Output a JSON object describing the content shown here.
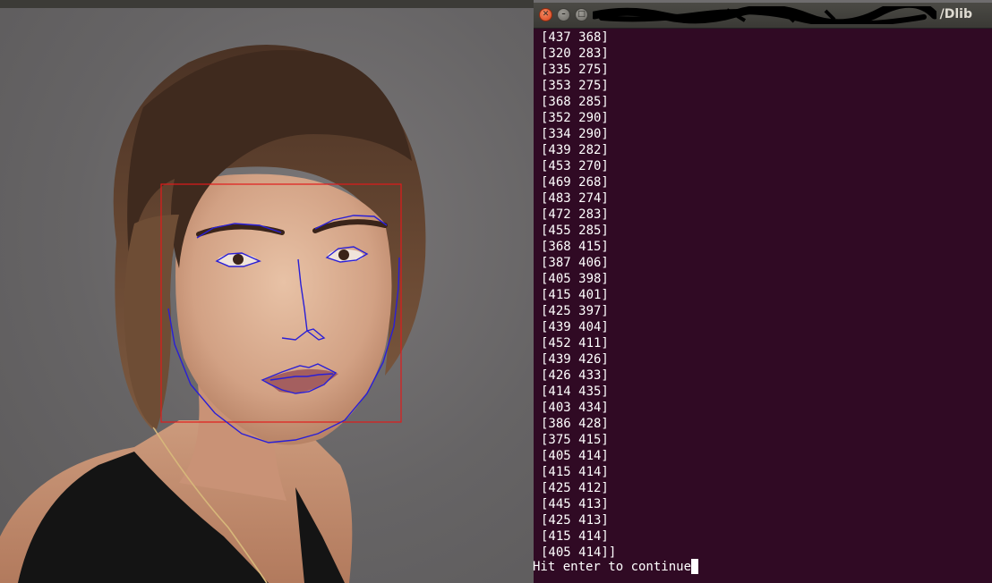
{
  "photo": {
    "colors": {
      "face_box": "#e21a1a",
      "landmarks": "#2a1fd6"
    }
  },
  "terminal": {
    "title_suffix": "/Dlib",
    "colors": {
      "background": "#300a24",
      "text": "#ffffff",
      "titlebar": "#3c3b37"
    },
    "lines": [
      "[437 368]",
      "[320 283]",
      "[335 275]",
      "[353 275]",
      "[368 285]",
      "[352 290]",
      "[334 290]",
      "[439 282]",
      "[453 270]",
      "[469 268]",
      "[483 274]",
      "[472 283]",
      "[455 285]",
      "[368 415]",
      "[387 406]",
      "[405 398]",
      "[415 401]",
      "[425 397]",
      "[439 404]",
      "[452 411]",
      "[439 426]",
      "[426 433]",
      "[414 435]",
      "[403 434]",
      "[386 428]",
      "[375 415]",
      "[405 414]",
      "[415 414]",
      "[425 412]",
      "[445 413]",
      "[425 413]",
      "[415 414]",
      "[405 414]]"
    ],
    "prompt": "Hit enter to continue"
  }
}
